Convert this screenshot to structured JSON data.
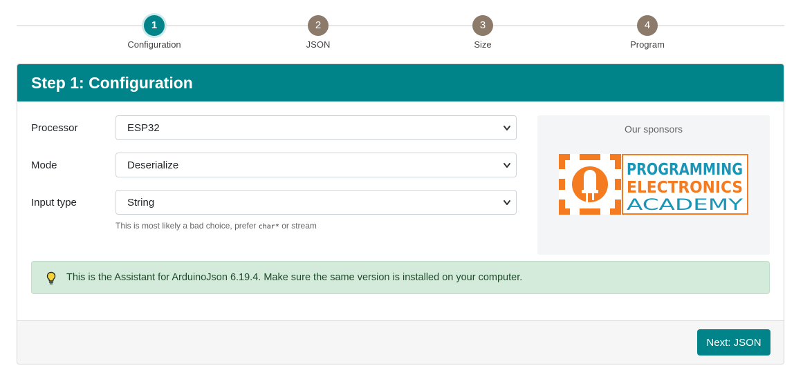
{
  "stepper": {
    "steps": [
      {
        "number": "1",
        "label": "Configuration",
        "active": true
      },
      {
        "number": "2",
        "label": "JSON",
        "active": false
      },
      {
        "number": "3",
        "label": "Size",
        "active": false
      },
      {
        "number": "4",
        "label": "Program",
        "active": false
      }
    ]
  },
  "card": {
    "title": "Step 1: Configuration"
  },
  "form": {
    "processor": {
      "label": "Processor",
      "value": "ESP32"
    },
    "mode": {
      "label": "Mode",
      "value": "Deserialize"
    },
    "input_type": {
      "label": "Input type",
      "value": "String"
    },
    "hint_prefix": "This is most likely a bad choice, prefer ",
    "hint_code": "char*",
    "hint_suffix": " or stream"
  },
  "sponsor": {
    "title": "Our sponsors",
    "logo_lines": [
      "PROGRAMMING",
      "ELECTRONICS",
      "ACADEMY"
    ]
  },
  "alert": {
    "text": "This is the Assistant for ArduinoJson 6.19.4. Make sure the same version is installed on your computer."
  },
  "footer": {
    "next_label": "Next: JSON"
  },
  "colors": {
    "accent": "#008489",
    "step_inactive": "#8c7a6b",
    "alert_bg": "#d4ebdb",
    "logo_orange": "#f47b20",
    "logo_blue": "#1b95b5"
  }
}
